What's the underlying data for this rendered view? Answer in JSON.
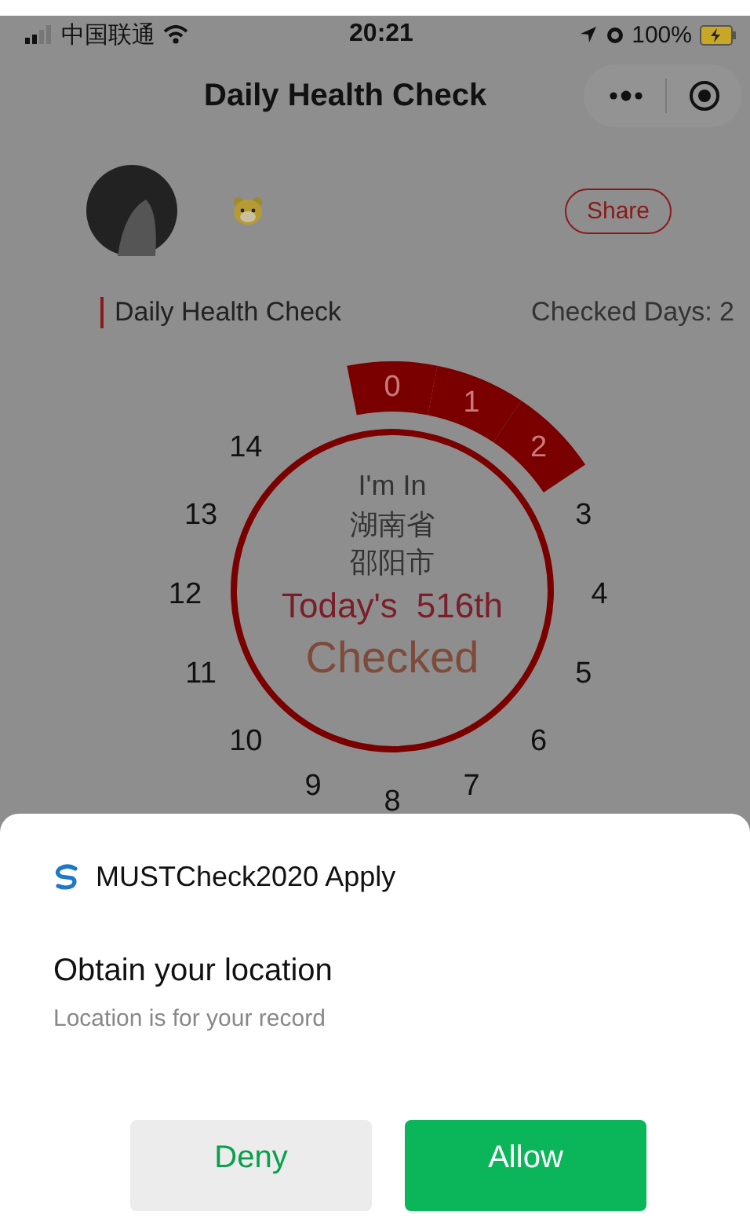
{
  "status_bar": {
    "carrier": "中国联通",
    "time": "20:21",
    "battery": "100%"
  },
  "nav_bar": {
    "title": "Daily Health Check"
  },
  "profile": {
    "share": "Share"
  },
  "section": {
    "title": "Daily Health Check",
    "checked_days": "Checked Days: 2"
  },
  "dial": {
    "days": [
      {
        "label": "0",
        "checked": true
      },
      {
        "label": "1",
        "checked": true
      },
      {
        "label": "2",
        "checked": true
      },
      {
        "label": "3",
        "checked": false
      },
      {
        "label": "4",
        "checked": false
      },
      {
        "label": "5",
        "checked": false
      },
      {
        "label": "6",
        "checked": false
      },
      {
        "label": "7",
        "checked": false
      },
      {
        "label": "8",
        "checked": false
      },
      {
        "label": "9",
        "checked": false
      },
      {
        "label": "10",
        "checked": false
      },
      {
        "label": "11",
        "checked": false
      },
      {
        "label": "12",
        "checked": false
      },
      {
        "label": "13",
        "checked": false
      },
      {
        "label": "14",
        "checked": false
      }
    ],
    "caption": "I'm In",
    "province": "湖南省",
    "city": "邵阳市",
    "rank_label": "Today's",
    "rank": "516th",
    "status": "Checked"
  },
  "dialog": {
    "app_name": "MUSTCheck2020 Apply",
    "title": "Obtain your location",
    "message": "Location is for your record",
    "buttons": [
      {
        "label": "Deny",
        "kind": "secondary"
      },
      {
        "label": "Allow",
        "kind": "primary"
      }
    ]
  }
}
